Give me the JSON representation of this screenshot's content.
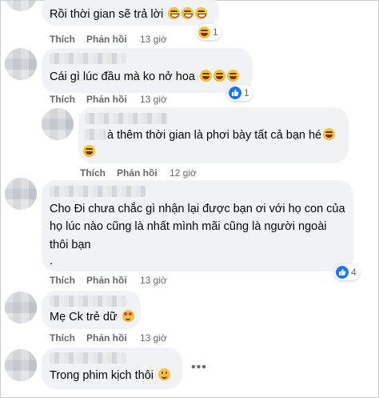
{
  "actions": {
    "like": "Thích",
    "reply": "Phản hồi"
  },
  "comments": [
    {
      "text": "Rồi thời gian sẽ trả lời",
      "time": "13 giờ",
      "reaction_count": "1"
    },
    {
      "text": "Cái gì lúc đầu mà ko nở hoa",
      "time": "13 giờ",
      "reaction_count": "1"
    },
    {
      "text_line1": "à thêm thời gian là phơi bày tất cả bạn hé",
      "time": "12 giờ"
    },
    {
      "text_line1": "Cho Đi chưa chắc gì nhận lại được bạn ơi với họ con của",
      "text_line2": "họ lúc nào cũng là nhất mình mãi cũng là người ngoài",
      "text_line3": "thôi bạn",
      "text_line4": ".",
      "time": "13 giờ",
      "reaction_count": "4"
    },
    {
      "text": "Mẹ Ck trẻ dữ",
      "time": "13 giờ"
    },
    {
      "text": "Trong phim kịch thôi",
      "more": "•••"
    }
  ],
  "icons": {
    "reaction_laugh": "laugh-emoji-icon",
    "reaction_like": "like-icon",
    "emoji_grin": "grin-emoji-icon",
    "emoji_love": "smiling-face-with-hearts-icon",
    "emoji_smile": "smile-emoji-icon"
  },
  "colors": {
    "bubble": "#f0f2f5",
    "meta_text": "#65676b",
    "like_blue": "#1877f2",
    "text": "#050505"
  }
}
